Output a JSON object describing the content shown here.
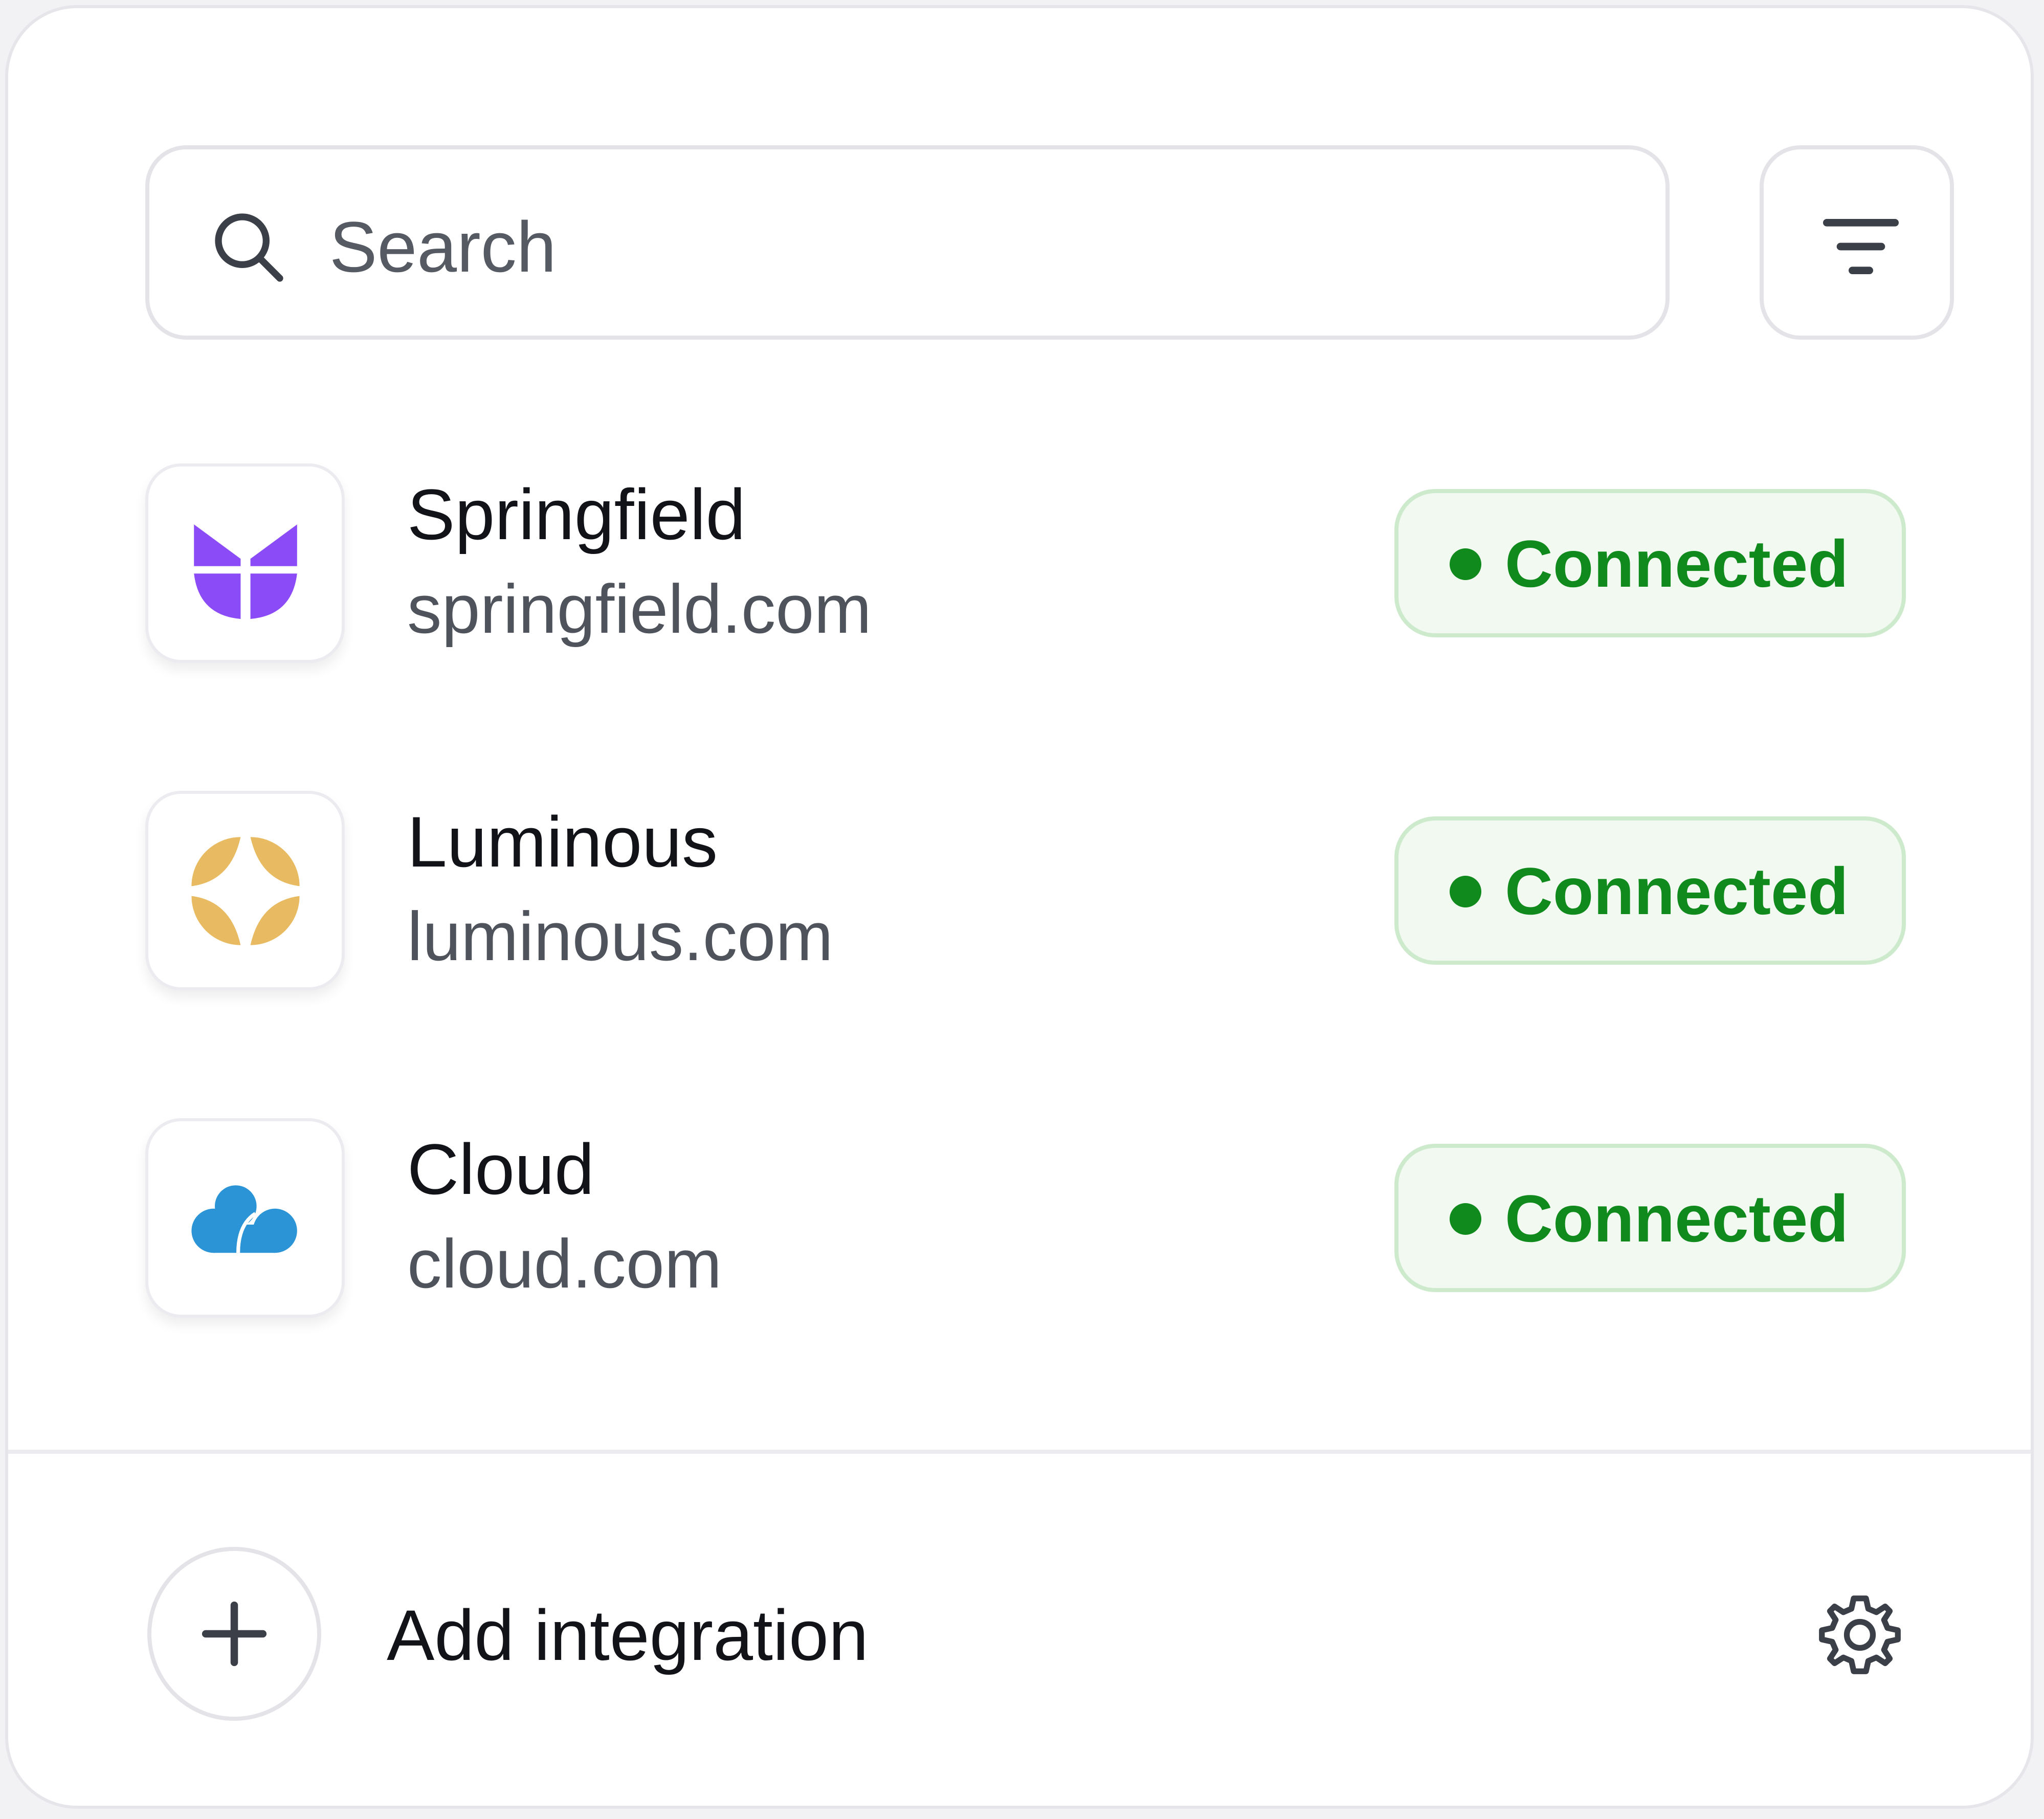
{
  "search": {
    "placeholder": "Search",
    "value": ""
  },
  "integrations": [
    {
      "name": "Springfield",
      "domain": "springfield.com",
      "status": "Connected",
      "logo_color": "#8b4cf7",
      "logo_icon": "tulip-icon"
    },
    {
      "name": "Luminous",
      "domain": "luminous.com",
      "status": "Connected",
      "logo_color": "#e8bb62",
      "logo_icon": "four-petal-icon"
    },
    {
      "name": "Cloud",
      "domain": "cloud.com",
      "status": "Connected",
      "logo_color": "#2a94d6",
      "logo_icon": "cloud-icon"
    }
  ],
  "footer": {
    "add_label": "Add integration"
  },
  "colors": {
    "status_green": "#108a1d",
    "badge_bg": "#f1f9f1",
    "badge_border": "#cdeacd"
  }
}
